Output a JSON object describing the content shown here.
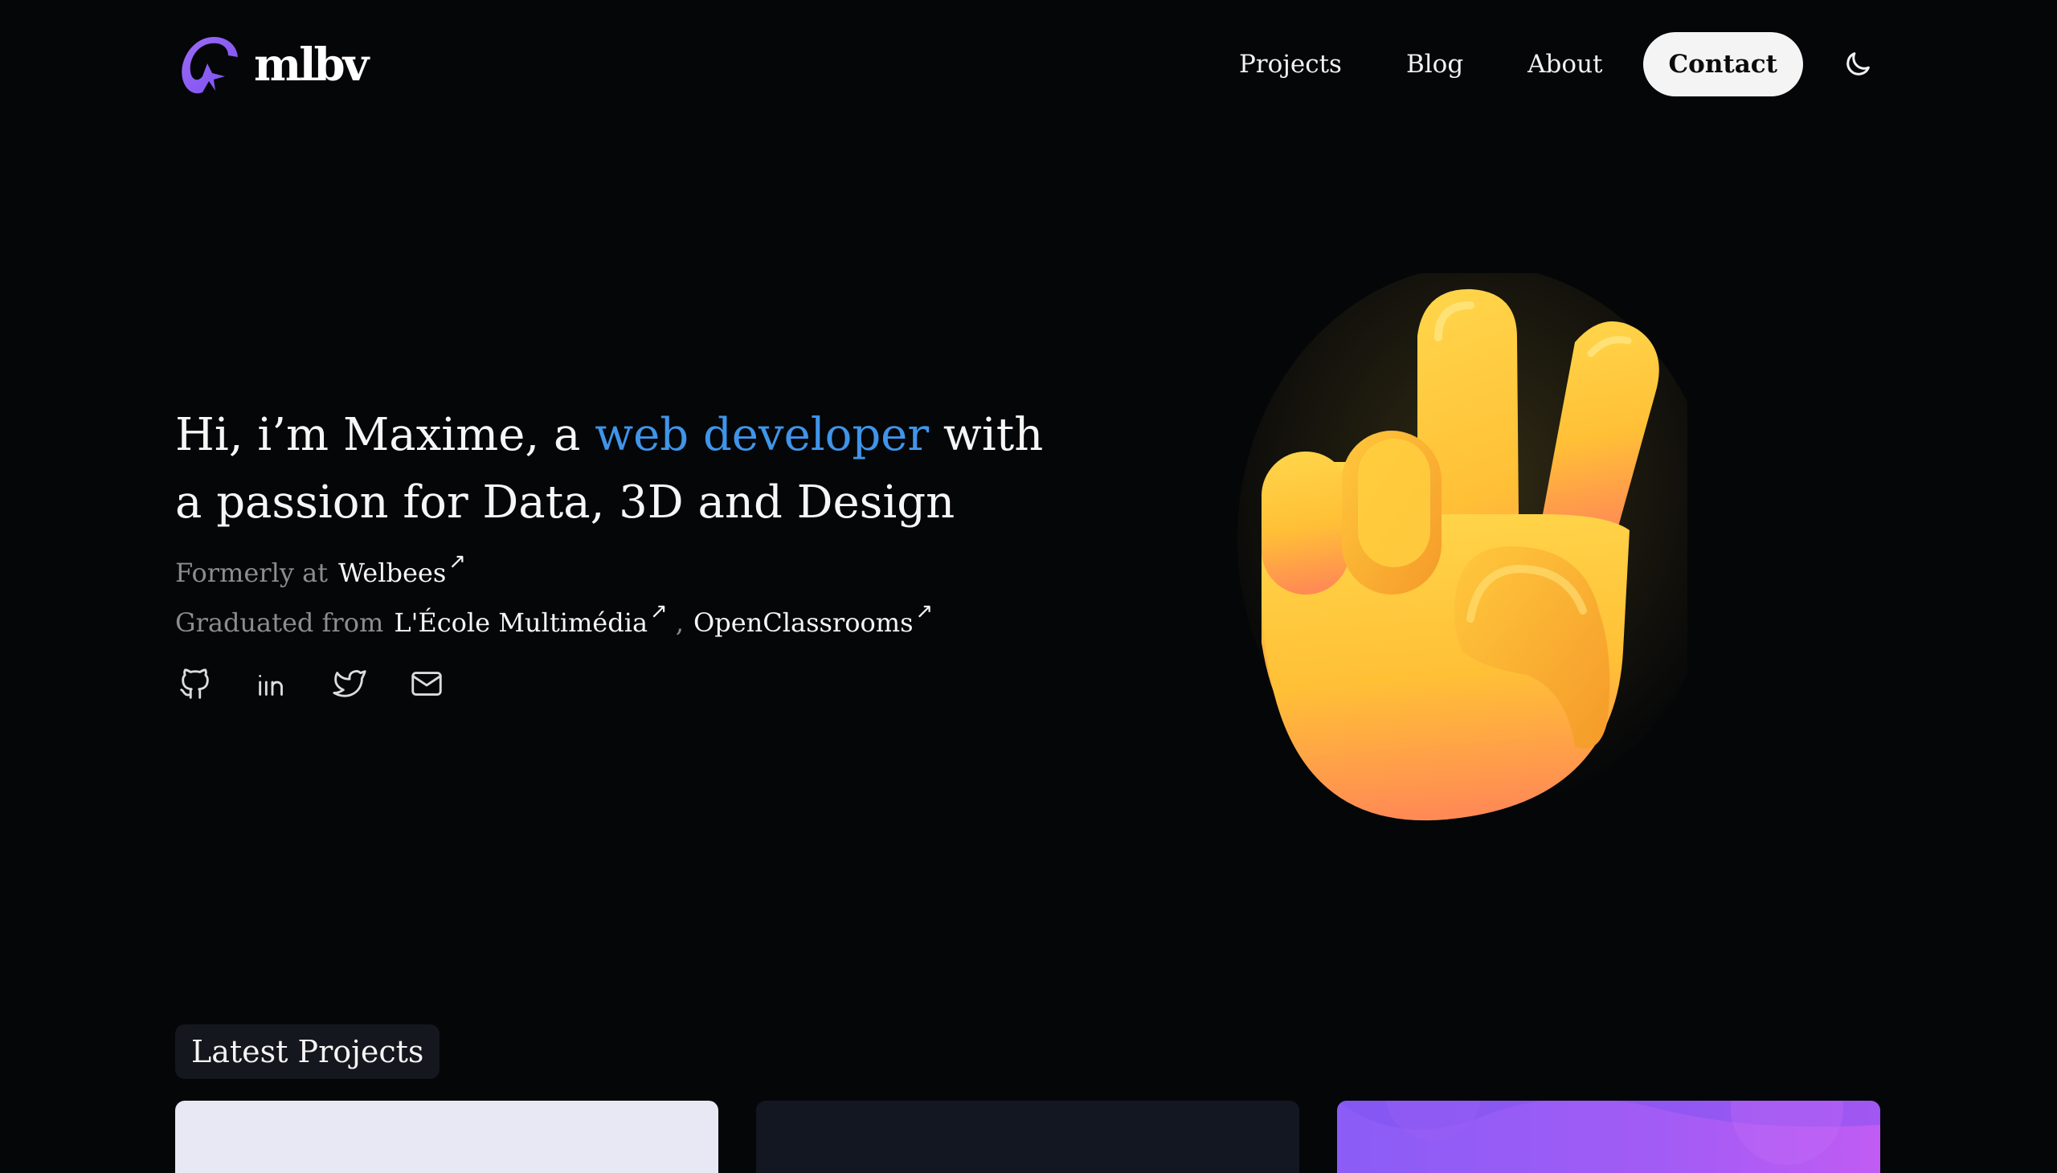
{
  "header": {
    "logo_text": "mlbv",
    "logo_icon": "swirl-star-logo-icon",
    "nav": [
      {
        "label": "Projects"
      },
      {
        "label": "Blog"
      },
      {
        "label": "About"
      }
    ],
    "contact_label": "Contact",
    "theme_icon": "moon-icon"
  },
  "hero": {
    "title_before": "Hi, i’m Maxime, a ",
    "title_accent": "web developer",
    "title_after": " with a passion for Data, 3D and Design",
    "formerly_label": "Formerly at",
    "formerly_company": "Welbees",
    "graduated_label": "Graduated from",
    "schools": [
      "L'École Multimédia",
      "OpenClassrooms"
    ],
    "separator": ",",
    "arrow": "↗",
    "illustration": "victory-hand-emoji",
    "socials": [
      {
        "icon": "github-icon"
      },
      {
        "icon": "linkedin-icon"
      },
      {
        "icon": "twitter-icon"
      },
      {
        "icon": "mail-icon"
      }
    ]
  },
  "projects": {
    "section_title": "Latest Projects"
  },
  "colors": {
    "background": "#050608",
    "accent": "#3f95ea",
    "logo": "#8b5cf6",
    "muted": "#8d8d8d"
  }
}
